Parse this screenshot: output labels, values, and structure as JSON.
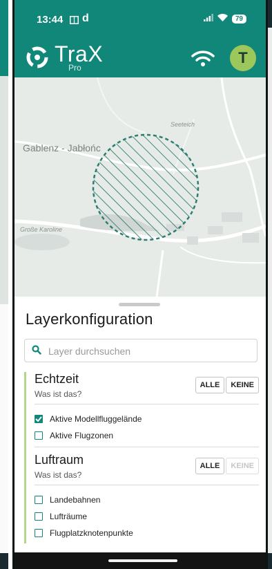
{
  "status": {
    "time": "13:44",
    "battery": "79",
    "extra_icon": "d"
  },
  "app": {
    "name": "TraX",
    "sub": "Pro",
    "avatar_initial": "T",
    "accent": "#11877a"
  },
  "map": {
    "labels": {
      "gablenz": "Gablenz - Jabłońc",
      "seeteich": "Seeteich",
      "grosse": "Große Karoline"
    }
  },
  "sheet": {
    "title": "Layerkonfiguration",
    "search_placeholder": "Layer durchsuchen",
    "groups": [
      {
        "title": "Echtzeit",
        "subtitle": "Was ist das?",
        "btn_all": "ALLE",
        "btn_none": "KEINE",
        "items": [
          {
            "label": "Aktive Modellfluggelände",
            "checked": true
          },
          {
            "label": "Aktive Flugzonen",
            "checked": false
          }
        ]
      },
      {
        "title": "Luftraum",
        "subtitle": "Was ist das?",
        "btn_all": "ALLE",
        "btn_none": "KEINE",
        "btn_none_disabled": true,
        "items": [
          {
            "label": "Landebahnen",
            "checked": false
          },
          {
            "label": "Lufträume",
            "checked": false
          },
          {
            "label": "Flugplatzknotenpunkte",
            "checked": false
          }
        ]
      }
    ]
  },
  "icons": [
    "mail-icon",
    "signal-icon",
    "wifi-icon",
    "battery-icon",
    "trax-logo-icon",
    "connection-wifi-icon",
    "search-icon",
    "check-icon"
  ]
}
